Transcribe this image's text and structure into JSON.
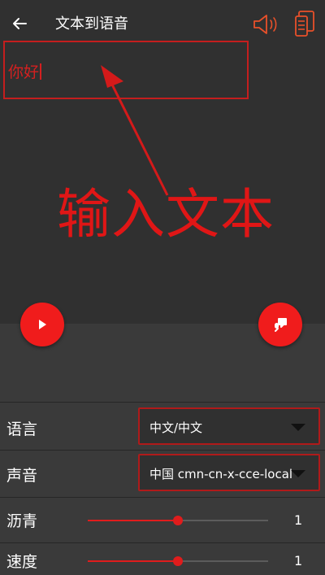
{
  "header": {
    "title": "文本到语音",
    "back_icon": "arrow-left-icon",
    "speaker_icon": "speaker-icon",
    "document_icon": "document-icon",
    "accent_color": "#e01616"
  },
  "editor": {
    "text": "你好"
  },
  "annotation": {
    "text": "输入文本"
  },
  "actions": {
    "play_icon": "play-icon",
    "mic_icon": "microphone-icon"
  },
  "settings": {
    "language": {
      "label": "语言",
      "value": "中文/中文"
    },
    "voice": {
      "label": "声音",
      "value": "中国 cmn-cn-x-cce-local"
    },
    "pitch": {
      "label": "沥青",
      "value": "1",
      "fraction": 0.5
    },
    "speed": {
      "label": "速度",
      "value": "1",
      "fraction": 0.5
    }
  }
}
